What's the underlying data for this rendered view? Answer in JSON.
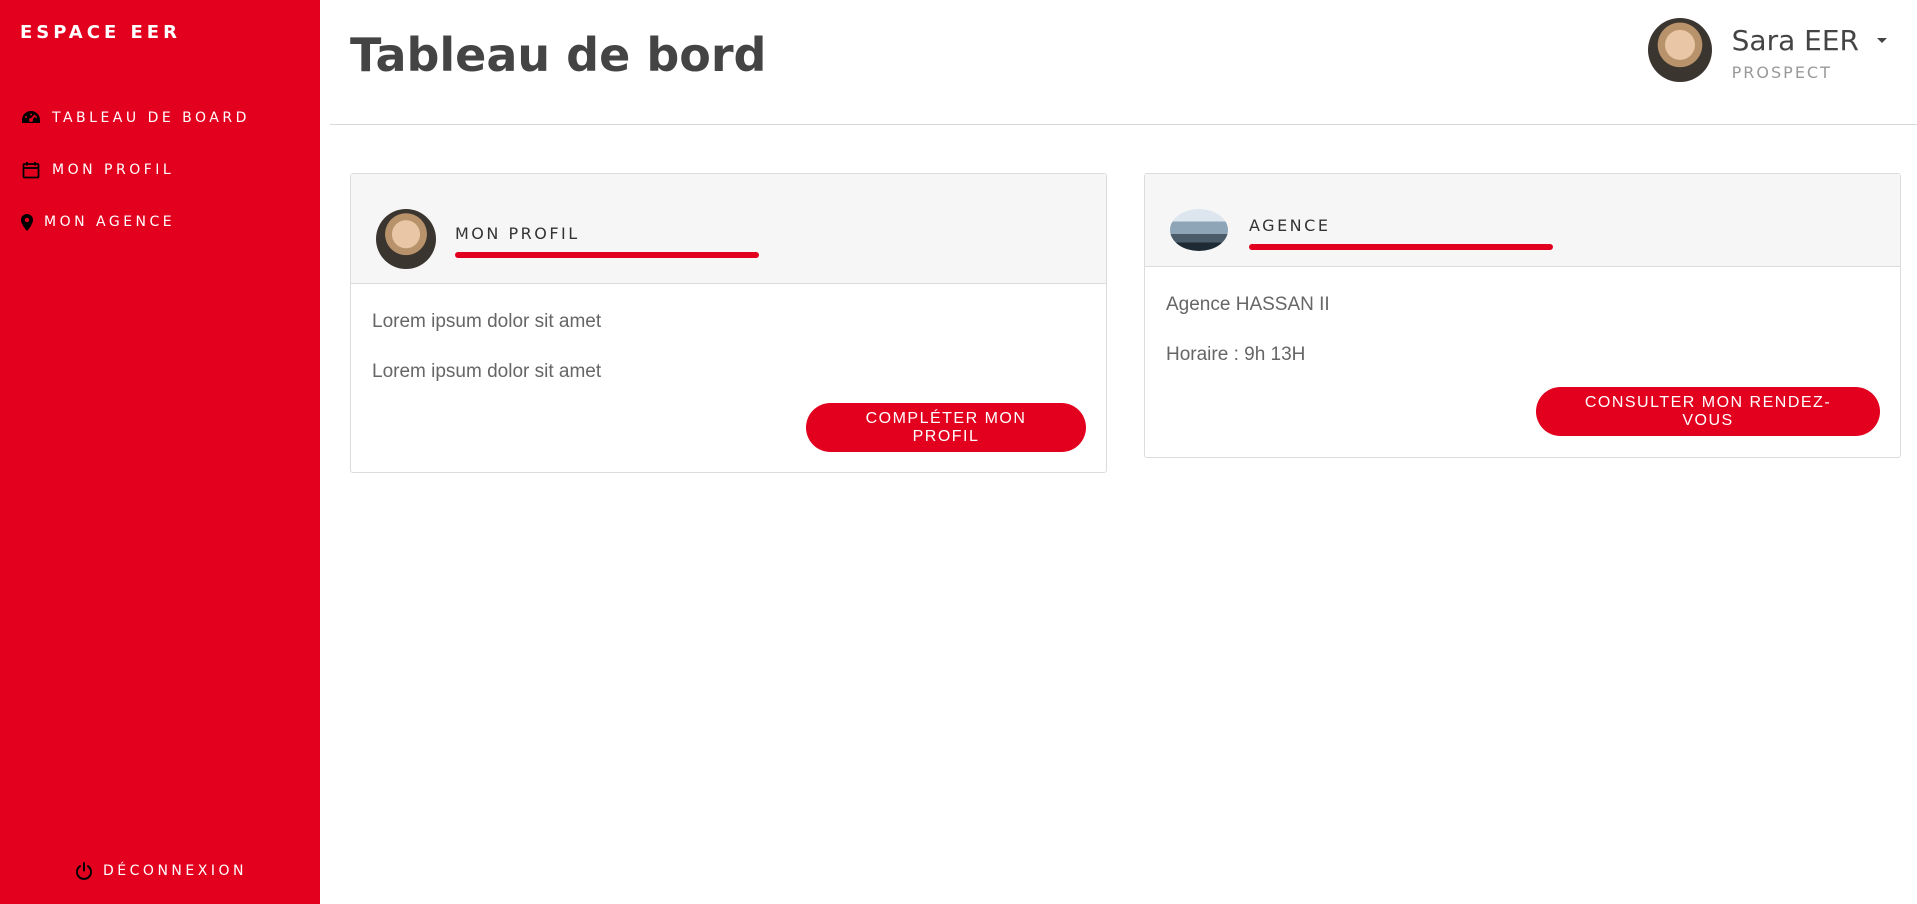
{
  "colors": {
    "accent": "#e2001e",
    "sidebar_bg": "#e2001e",
    "text": "#444444",
    "muted": "#999999"
  },
  "sidebar": {
    "brand": "ESPACE EER",
    "items": [
      {
        "label": "TABLEAU DE BOARD",
        "icon": "speedometer-icon"
      },
      {
        "label": "MON PROFIL",
        "icon": "calendar-icon"
      },
      {
        "label": "MON AGENCE",
        "icon": "map-pin-icon"
      }
    ],
    "logout": {
      "label": "DÉCONNEXION",
      "icon": "power-icon"
    }
  },
  "header": {
    "title": "Tableau de bord",
    "user": {
      "name": "Sara EER",
      "role": "PROSPECT"
    }
  },
  "cards": {
    "profile": {
      "title": "MON PROFIL",
      "lines": [
        "Lorem ipsum dolor sit amet",
        "Lorem ipsum dolor sit amet"
      ],
      "button": "COMPLÉTER MON PROFIL"
    },
    "agency": {
      "title": "AGENCE",
      "lines": [
        "Agence HASSAN II",
        "Horaire : 9h 13H"
      ],
      "button": "CONSULTER MON RENDEZ-VOUS"
    }
  }
}
